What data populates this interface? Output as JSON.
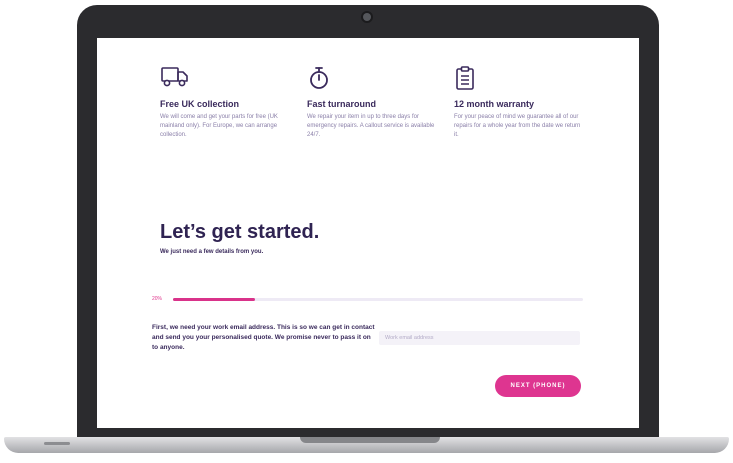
{
  "features": [
    {
      "icon": "truck-icon",
      "title": "Free UK collection",
      "desc": "We will come and get your parts for free (UK mainland only). For Europe, we can arrange collection."
    },
    {
      "icon": "stopwatch-icon",
      "title": "Fast turnaround",
      "desc": "We repair your item in up to three days for emergency repairs. A callout service is available 24/7."
    },
    {
      "icon": "clipboard-checklist-icon",
      "title": "12 month warranty",
      "desc": "For your peace of mind we guarantee all of our repairs for a whole year from the date we return it."
    }
  ],
  "form": {
    "title": "Let’s get started.",
    "subtitle": "We just need a few details from you.",
    "progress_label": "20%",
    "progress_fraction": 0.2,
    "intro": "First, we need your work email address. This is so we can get in contact and send you your personalised quote. We promise never to pass it on to anyone.",
    "email_placeholder": "Work email address",
    "next_label": "NEXT (PHONE)"
  },
  "colors": {
    "accent": "#de3590",
    "heading": "#2f2352",
    "body_text": "#8a7fa8"
  }
}
